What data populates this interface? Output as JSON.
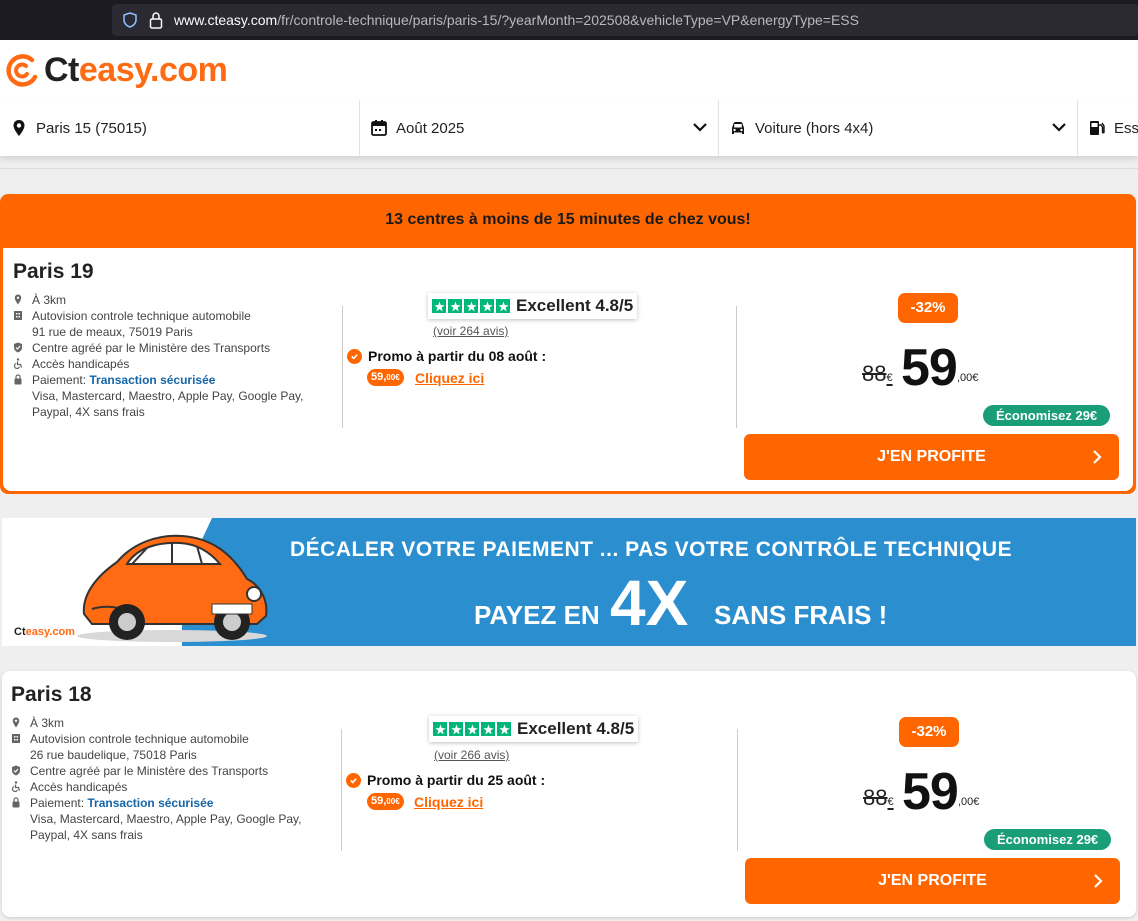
{
  "browser": {
    "url_host": "www.cteasy.com",
    "url_path": "/fr/controle-technique/paris/paris-15/?yearMonth=202508&vehicleType=VP&energyType=ESS"
  },
  "site": {
    "logo_ct": "Ct",
    "logo_rest": "easy.com",
    "brand_color": "#ff6a13"
  },
  "search": {
    "location": "Paris 15 (75015)",
    "date": "Août 2025",
    "vehicle": "Voiture (hors 4x4)",
    "energy": "Ess"
  },
  "promo_header": "13 centres à moins de 15 minutes de chez vous!",
  "centers": [
    {
      "city": "Paris 19",
      "distance": "À 3km",
      "name": "Autovision controle technique automobile",
      "address": "91 rue de meaux, 75019 Paris",
      "agreement": "Centre agréé par le Ministère des Transports",
      "access": "Accès handicapés",
      "payment_label": "Paiement: ",
      "payment_secure": "Transaction sécurisée",
      "payment_methods": "Visa, Mastercard, Maestro, Apple Pay, Google Pay, Paypal, 4X sans frais",
      "rating_text": "Excellent 4.8/5",
      "reviews": "(voir 264 avis)",
      "promo_text": "Promo à partir du 08 août :",
      "promo_price": "59,",
      "promo_cents": "00€",
      "promo_link": "Cliquez ici",
      "discount": "-32%",
      "old_price": "88",
      "old_currency": "€",
      "price": "59",
      "price_cents": ",00€",
      "savings": "Économisez 29€",
      "cta": "J'EN PROFITE"
    },
    {
      "city": "Paris 18",
      "distance": "À 3km",
      "name": "Autovision controle technique automobile",
      "address": "26 rue baudelique, 75018 Paris",
      "agreement": "Centre agréé par le Ministère des Transports",
      "access": "Accès handicapés",
      "payment_label": "Paiement: ",
      "payment_secure": "Transaction sécurisée",
      "payment_methods": "Visa, Mastercard, Maestro, Apple Pay, Google Pay, Paypal, 4X sans frais",
      "rating_text": "Excellent 4.8/5",
      "reviews": "(voir 266 avis)",
      "promo_text": "Promo à partir du 25 août :",
      "promo_price": "59,",
      "promo_cents": "00€",
      "promo_link": "Cliquez ici",
      "discount": "-32%",
      "old_price": "88",
      "old_currency": "€",
      "price": "59",
      "price_cents": ",00€",
      "savings": "Économisez 29€",
      "cta": "J'EN PROFITE"
    }
  ],
  "banner": {
    "line1": "DÉCALER VOTRE PAIEMENT ... PAS VOTRE CONTRÔLE TECHNIQUE",
    "line2a": "PAYEZ EN",
    "line2b": "4X",
    "line2c": "SANS FRAIS !",
    "logo_ct": "Ct",
    "logo_rest": "easy.com"
  }
}
